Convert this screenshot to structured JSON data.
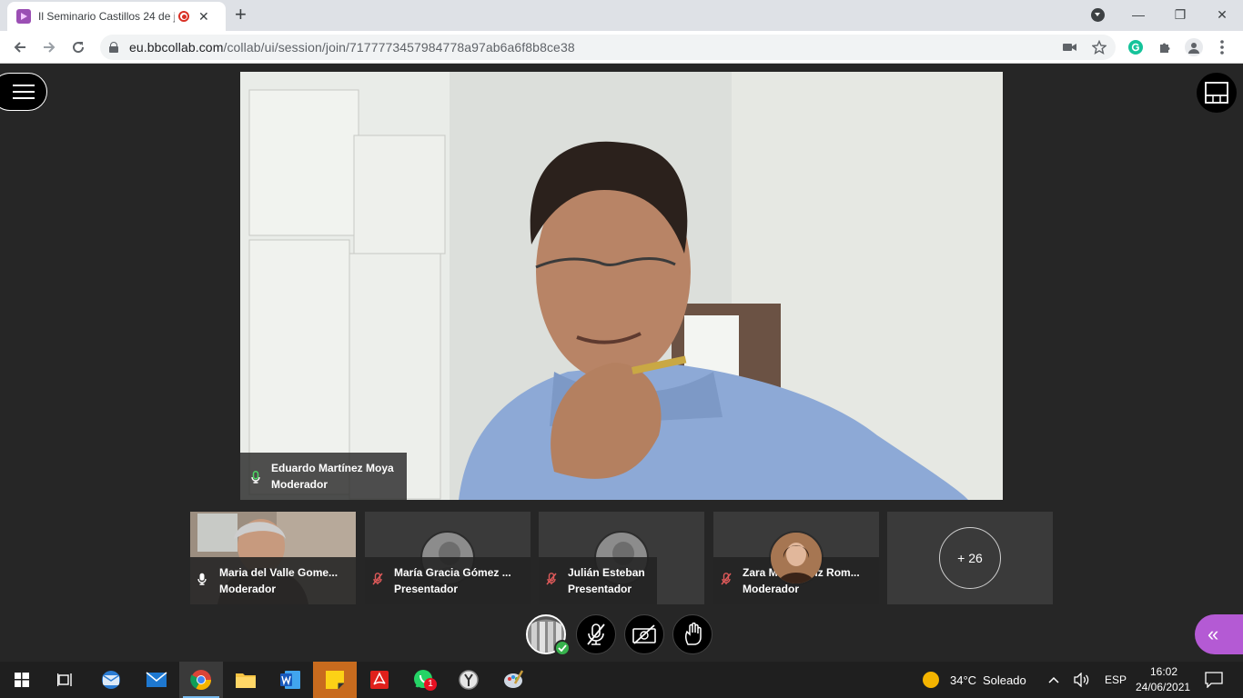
{
  "browser": {
    "tab_title": "Il Seminario Castillos 24 de j",
    "new_tab": "+",
    "url_host": "eu.bbcollab.com",
    "url_path": "/collab/ui/session/join/7177773457984778a97ab6a6f8b8ce38",
    "window_minimize": "—",
    "window_restore": "❐",
    "window_close": "✕",
    "tab_close": "✕"
  },
  "session": {
    "main_speaker": {
      "name": "Eduardo Martínez Moya",
      "role": "Moderador"
    },
    "participants": [
      {
        "name": "Maria del Valle Gome...",
        "role": "Moderador"
      },
      {
        "name": "María Gracia Gómez ...",
        "role": "Presentador"
      },
      {
        "name": "Julián Esteban",
        "role": "Presentador"
      },
      {
        "name": "Zara Maria Ruiz Rom...",
        "role": "Moderador"
      }
    ],
    "more_count": "+ 26",
    "panel_toggle": "«"
  },
  "taskbar": {
    "weather_temp": "34°C",
    "weather_text": "Soleado",
    "language": "ESP",
    "time": "16:02",
    "date": "24/06/2021",
    "whatsapp_badge": "1"
  },
  "colors": {
    "accent_purple": "#b45ad4",
    "status_green": "#37b24d",
    "stage_bg": "#262626"
  }
}
